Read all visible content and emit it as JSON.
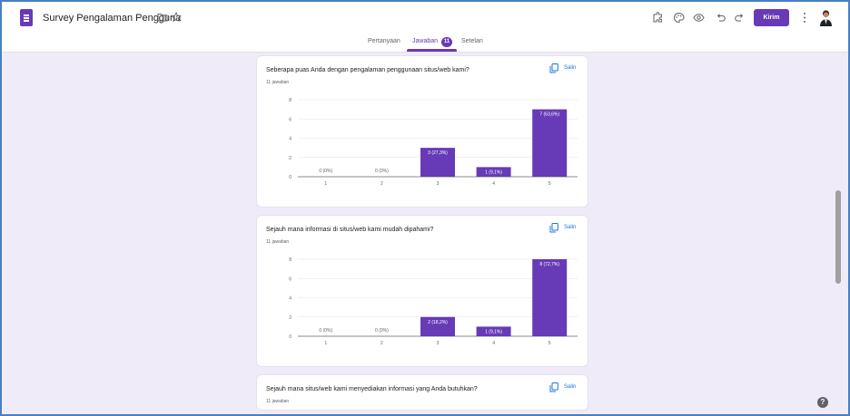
{
  "header": {
    "title": "Survey Pengalaman Pengguna",
    "send_label": "Kirim",
    "icons": [
      "forms-logo-icon",
      "folder-icon",
      "star-icon",
      "addon-icon",
      "palette-icon",
      "preview-eye-icon",
      "undo-icon",
      "redo-icon",
      "more-vert-icon",
      "avatar"
    ]
  },
  "tabs": {
    "questions": "Pertanyaan",
    "answers": "Jawaban",
    "answers_count": "11",
    "settings": "Setelan"
  },
  "colors": {
    "accent": "#673ab7",
    "background": "#f0ebf8",
    "link": "#1a73e8"
  },
  "questions": [
    {
      "title": "Seberapa puas Anda dengan pengalaman penggunaan situs/web kami?",
      "count": "11 jawaban",
      "copy_label": "Salin",
      "chart_data": {
        "type": "bar",
        "categories": [
          "1",
          "2",
          "3",
          "4",
          "5"
        ],
        "values": [
          0,
          0,
          3,
          1,
          7
        ],
        "labels": [
          "0 (0%)",
          "0 (0%)",
          "3 (27,3%)",
          "1 (9,1%)",
          "7 (63,6%)"
        ],
        "yticks": [
          "0",
          "2",
          "4",
          "6",
          "8"
        ],
        "ylim": [
          0,
          8
        ],
        "grid": true
      }
    },
    {
      "title": "Sejauh mana informasi di situs/web kami mudah dipahami?",
      "count": "11 jawaban",
      "copy_label": "Salin",
      "chart_data": {
        "type": "bar",
        "categories": [
          "1",
          "2",
          "3",
          "4",
          "5"
        ],
        "values": [
          0,
          0,
          2,
          1,
          8
        ],
        "labels": [
          "0 (0%)",
          "0 (0%)",
          "2 (18,2%)",
          "1 (9,1%)",
          "8 (72,7%)"
        ],
        "yticks": [
          "0",
          "2",
          "4",
          "6",
          "8"
        ],
        "ylim": [
          0,
          8
        ],
        "grid": true
      }
    },
    {
      "title": "Sejauh mana situs/web kami menyediakan informasi yang Anda butuhkan?",
      "count": "11 jawaban",
      "copy_label": "Salin"
    }
  ]
}
